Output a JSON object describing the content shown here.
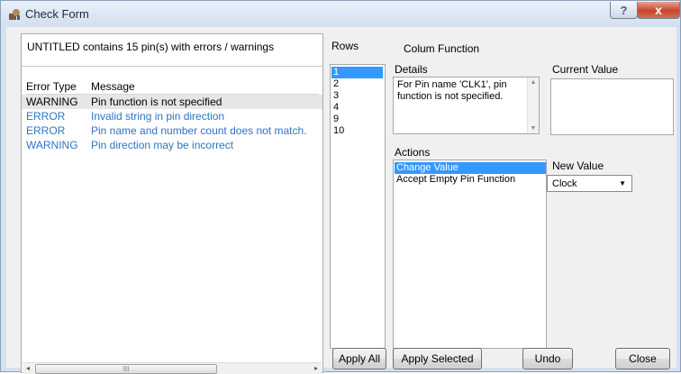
{
  "window": {
    "title": "Check Form",
    "help_label": "?",
    "close_label": "x"
  },
  "left": {
    "summary": "UNTITLED contains 15 pin(s) with errors / warnings",
    "headers": {
      "error_type": "Error Type",
      "message": "Message"
    },
    "rows": [
      {
        "type": "WARNING",
        "message": "Pin function is not specified"
      },
      {
        "type": "ERROR",
        "message": "Invalid string in pin direction"
      },
      {
        "type": "ERROR",
        "message": "Pin name and number count does not match."
      },
      {
        "type": "WARNING",
        "message": "Pin direction may be incorrect"
      }
    ],
    "scroll_thumb_grip": "III"
  },
  "right": {
    "rows_label": "Rows",
    "column_function_label": "Colum Function",
    "rows": [
      "1",
      "2",
      "3",
      "4",
      "9",
      "10"
    ],
    "details_label": "Details",
    "details_text": "For Pin name 'CLK1', pin function is not specified.",
    "current_value_label": "Current Value",
    "actions_label": "Actions",
    "actions": [
      "Change Value",
      "Accept Empty Pin Function"
    ],
    "new_value_label": "New Value",
    "new_value_selected": "Clock"
  },
  "buttons": {
    "apply_all": "Apply All",
    "apply_selected": "Apply Selected",
    "undo": "Undo",
    "close": "Close"
  },
  "colors": {
    "selection": "#3399ff",
    "error_text": "#2f74c2"
  }
}
